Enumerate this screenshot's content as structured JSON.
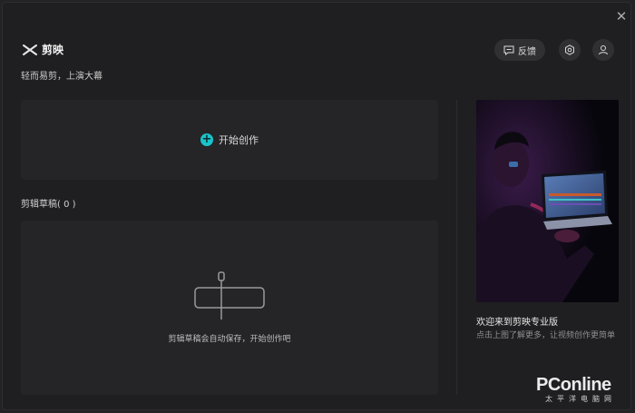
{
  "window": {
    "close_glyph": "✕"
  },
  "header": {
    "app_name": "剪映",
    "slogan": "轻而易剪，上演大幕",
    "feedback_label": "反馈",
    "icons": {
      "logo": "scissors-logo-icon",
      "feedback": "chat-bubble-icon",
      "settings": "hexagon-settings-icon",
      "user": "user-icon",
      "close": "close-icon"
    }
  },
  "start": {
    "label": "开始创作",
    "icon": "plus-circle-icon",
    "accent": "#19c3c9"
  },
  "drafts": {
    "title": "剪辑草稿( 0 )",
    "empty_text": "剪辑草稿会自动保存，开始创作吧",
    "icon": "timeline-clip-icon"
  },
  "promo": {
    "title": "欢迎来到剪映专业版",
    "description": "点击上图了解更多，让视频创作更简单"
  },
  "watermark": {
    "main": "PConline",
    "sub": "太平洋电脑网"
  }
}
